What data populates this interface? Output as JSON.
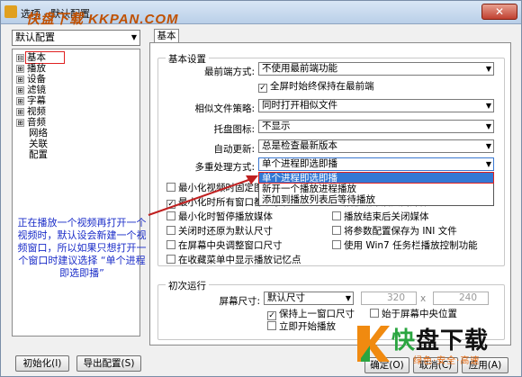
{
  "window": {
    "title": "选项 - 默认配置",
    "watermark": "快盘下载 KKPAN.COM",
    "close_symbol": "✕"
  },
  "sidebar": {
    "preset": "默认配置",
    "tree": [
      {
        "label": "基本",
        "expander": "⊟",
        "selected": true
      },
      {
        "label": "播放",
        "expander": "⊞"
      },
      {
        "label": "设备",
        "expander": "⊞"
      },
      {
        "label": "滤镜",
        "expander": "⊞"
      },
      {
        "label": "字幕",
        "expander": "⊞"
      },
      {
        "label": "视频",
        "expander": "⊞"
      },
      {
        "label": "音频",
        "expander": "⊞"
      },
      {
        "label": "网络"
      },
      {
        "label": "关联"
      },
      {
        "label": "配置"
      }
    ],
    "note": "正在播放一个视频再打开一个视频时，默认设会新建一个视频窗口，所以如果只想打开一个窗口时建议选择 “单个进程即选即播”"
  },
  "tab": {
    "label": "基本"
  },
  "basic": {
    "group_label": "基本设置",
    "topmost": {
      "label": "最前端方式:",
      "value": "不使用最前端功能"
    },
    "fullscreen_topmost": {
      "label": "全屏时始终保持在最前端",
      "checked": true
    },
    "similar_files": {
      "label": "相似文件策略:",
      "value": "同时打开相似文件"
    },
    "tray_icon": {
      "label": "托盘图标:",
      "value": "不显示"
    },
    "auto_update": {
      "label": "自动更新:",
      "value": "总是检查最新版本"
    },
    "multi_process": {
      "label": "多重处理方式:",
      "value": "单个进程即选即播"
    },
    "multi_process_options": [
      "单个进程即选即播",
      "新开一个播放进程播放",
      "添加到播放列表后等待播放"
    ],
    "checkboxes_left": [
      {
        "label": "最小化视频时固定图标",
        "checked": false
      },
      {
        "label": "最小化时所有窗口都最小化",
        "checked": true
      },
      {
        "label": "最小化时暂停播放媒体",
        "checked": false
      },
      {
        "label": "关闭时还原为默认尺寸",
        "checked": false
      },
      {
        "label": "在屏幕中央调整窗口尺寸",
        "checked": false
      },
      {
        "label": "在收藏菜单中显示播放记忆点",
        "checked": false
      }
    ],
    "checkboxes_right": [
      {
        "label": "播放结束后关闭媒体",
        "checked": false
      },
      {
        "label": "播放结束后关闭媒体",
        "checked": false
      },
      {
        "label": "将参数配置保存为 INI 文件",
        "checked": false
      },
      {
        "label": "使用 Win7 任务栏播放控制功能",
        "checked": false
      }
    ]
  },
  "initial": {
    "group_label": "初次运行",
    "screen_size": {
      "label": "屏幕尺寸:",
      "value": "默认尺寸",
      "width": "320",
      "height": "240",
      "times": "x"
    },
    "keep_last": {
      "label": "保持上一窗口尺寸",
      "checked": true
    },
    "start_center": {
      "label": "始于屏幕中央位置",
      "checked": false
    },
    "autoplay": {
      "label": "立即开始播放",
      "checked": false
    }
  },
  "footer": {
    "init_button": "初始化(I)",
    "export_button": "导出配置(S)",
    "ok_button": "确定(O)",
    "cancel_button": "取消(C)",
    "apply_button": "应用(A)"
  },
  "logo": {
    "text_black": "盘下载",
    "text_green": "快",
    "subtitle": "绿色·安全·高速"
  },
  "colors": {
    "highlight_red": "#e02020",
    "note_blue": "#1a2cc8",
    "selection_blue": "#3378d4"
  }
}
